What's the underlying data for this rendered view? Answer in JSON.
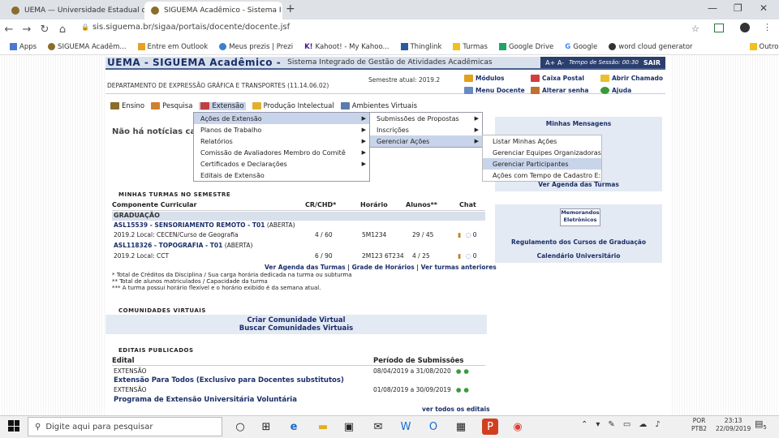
{
  "browser": {
    "tabs": [
      {
        "title": "UEMA — Universidade Estadual d",
        "active": false
      },
      {
        "title": "SIGUEMA Acadêmico - Sistema I",
        "active": true
      }
    ],
    "url": "sis.siguema.br/sigaa/portais/docente/docente.jsf",
    "bookmarks": [
      "Apps",
      "SIGUEMA Acadêm...",
      "Entre em Outlook",
      "Meus prezis | Prezi",
      "Kahoot! - My Kahoo...",
      "Thinglink",
      "Turmas",
      "Google Drive",
      "Google",
      "word cloud generator",
      "Outros favoritos"
    ]
  },
  "header": {
    "brand": "UEMA - SIGUEMA Acadêmico -",
    "subtitle": "Sistema Integrado de Gestão de Atividades Acadêmicas",
    "font_controls": "A+ A-",
    "session": "Tempo de Sessão: 00:30",
    "logout": "SAIR"
  },
  "department": "DEPARTAMENTO DE EXPRESSÃO GRÁFICA E TRANSPORTES (11.14.06.02)",
  "semester": "Semestre atual: 2019.2",
  "quick_links": [
    "Módulos",
    "Caixa Postal",
    "Abrir Chamado",
    "Menu Docente",
    "Alterar senha",
    "Ajuda"
  ],
  "menu": [
    "Ensino",
    "Pesquisa",
    "Extensão",
    "Produção Intelectual",
    "Ambientes Virtuais"
  ],
  "no_news": "Não há notícias cad",
  "dropdown1": [
    "Ações de Extensão",
    "Planos de Trabalho",
    "Relatórios",
    "Comissão de Avaliadores Membro do Comitê",
    "Certificados e Declarações",
    "Editais de Extensão"
  ],
  "dropdown2": [
    "Submissões de Propostas",
    "Inscrições",
    "Gerenciar Ações"
  ],
  "dropdown3": [
    "Listar Minhas Ações",
    "Gerenciar Equipes Organizadoras",
    "Gerenciar Participantes",
    "Ações com Tempo de Cadastro E:"
  ],
  "right_panel": {
    "messages": "Minhas Mensagens",
    "agenda": "Ver Agenda das Turmas",
    "memorandos_1": "Memorandos",
    "memorandos_2": "Eletrônicos",
    "regulamento": "Regulamento dos Cursos de Graduação",
    "calendario": "Calendário Universitário"
  },
  "turmas": {
    "section": "MINHAS TURMAS NO SEMESTRE",
    "columns": [
      "Componente Curricular",
      "CR/CHD*",
      "Horário",
      "Alunos**",
      "Chat"
    ],
    "group": "GRADUAÇÃO",
    "rows": [
      {
        "code": "ASL15539 - SENSORIAMENTO REMOTO - T01",
        "status": "(ABERTA)",
        "local": "2019.2 Local: CECEN/Curso de Geografia",
        "cr": "4 / 60",
        "horario": "5M1234",
        "alunos": "29 / 45",
        "chat": "0"
      },
      {
        "code": "ASL118326 - TOPOGRAFIA - T01",
        "status": "(ABERTA)",
        "local": "2019.2 Local: CCT",
        "cr": "6 / 90",
        "horario": "2M123 6T234",
        "alunos": "4 / 25",
        "chat": "0"
      }
    ],
    "links": "Ver Agenda das Turmas | Grade de Horários | Ver turmas anteriores",
    "note1": "* Total de Créditos da Disciplina / Sua carga horária dedicada na turma ou subturma",
    "note2": "** Total de alunos matriculados / Capacidade da turma",
    "note3": "*** A turma possui horário flexível e o horário exibido é da semana atual."
  },
  "comunidades": {
    "section": "COMUNIDADES VIRTUAIS",
    "create": "Criar Comunidade Virtual",
    "search": "Buscar Comunidades Virtuais"
  },
  "editais": {
    "section": "EDITAIS PUBLICADOS",
    "col1": "Edital",
    "col2": "Período de Submissões",
    "rows": [
      {
        "type": "EXTENSÃO",
        "title": "Extensão Para Todos (Exclusivo para Docentes substitutos)",
        "period": "08/04/2019 a 31/08/2020"
      },
      {
        "type": "EXTENSÃO",
        "title": "Programa de Extensão Universitária Voluntária",
        "period": "01/08/2019 a 30/09/2019"
      }
    ],
    "see_all": "ver todos os editais"
  },
  "taskbar": {
    "search_placeholder": "Digite aqui para pesquisar",
    "lang1": "POR",
    "lang2": "PTB2",
    "time": "23:13",
    "date": "22/09/2019",
    "notif": "5"
  }
}
